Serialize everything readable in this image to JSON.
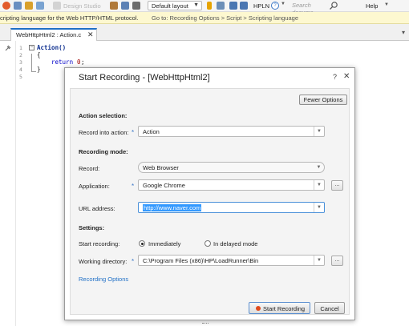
{
  "toolbar": {
    "design_studio_label": "Design Studio",
    "layout_value": "Default layout",
    "protocol_label": "HPLN",
    "search_placeholder": "Search docume...",
    "help_label": "Help"
  },
  "hint": {
    "text": "cripting language for the Web HTTP/HTML protocol.",
    "link": "Go to: Recording Options > Script > Scripting language"
  },
  "editor": {
    "tab_label": "WebHttpHtml2 : Action.c",
    "lines": [
      "1",
      "2",
      "3",
      "4",
      "5"
    ],
    "code": {
      "line1": "Action()",
      "line2": "{",
      "line3_kw": "return",
      "line3_num": "0",
      "line4": "}"
    }
  },
  "dialog": {
    "title": "Start Recording - [WebHttpHtml2]",
    "help": "?",
    "close": "✕",
    "fewer_options": "Fewer Options",
    "action_section": "Action selection:",
    "record_into_label": "Record into action:",
    "record_into_value": "Action",
    "mode_section": "Recording mode:",
    "record_label": "Record:",
    "record_value": "Web Browser",
    "application_label": "Application:",
    "application_value": "Google Chrome",
    "url_label": "URL address:",
    "url_value": "http://www.naver.com",
    "settings_section": "Settings:",
    "start_recording_label": "Start recording:",
    "start_option_immediately": "Immediately",
    "start_option_delayed": "In delayed mode",
    "working_dir_label": "Working directory:",
    "working_dir_value": "C:\\Program Files (x86)\\HP\\LoadRunner\\Bin",
    "recording_options_link": "Recording Options",
    "start_button": "Start Recording",
    "cancel_button": "Cancel",
    "browse": "..."
  },
  "colors": {
    "accent": "#1f6fc6",
    "hint_bg": "#fdf8d0",
    "record_dot": "#e04a1c"
  }
}
